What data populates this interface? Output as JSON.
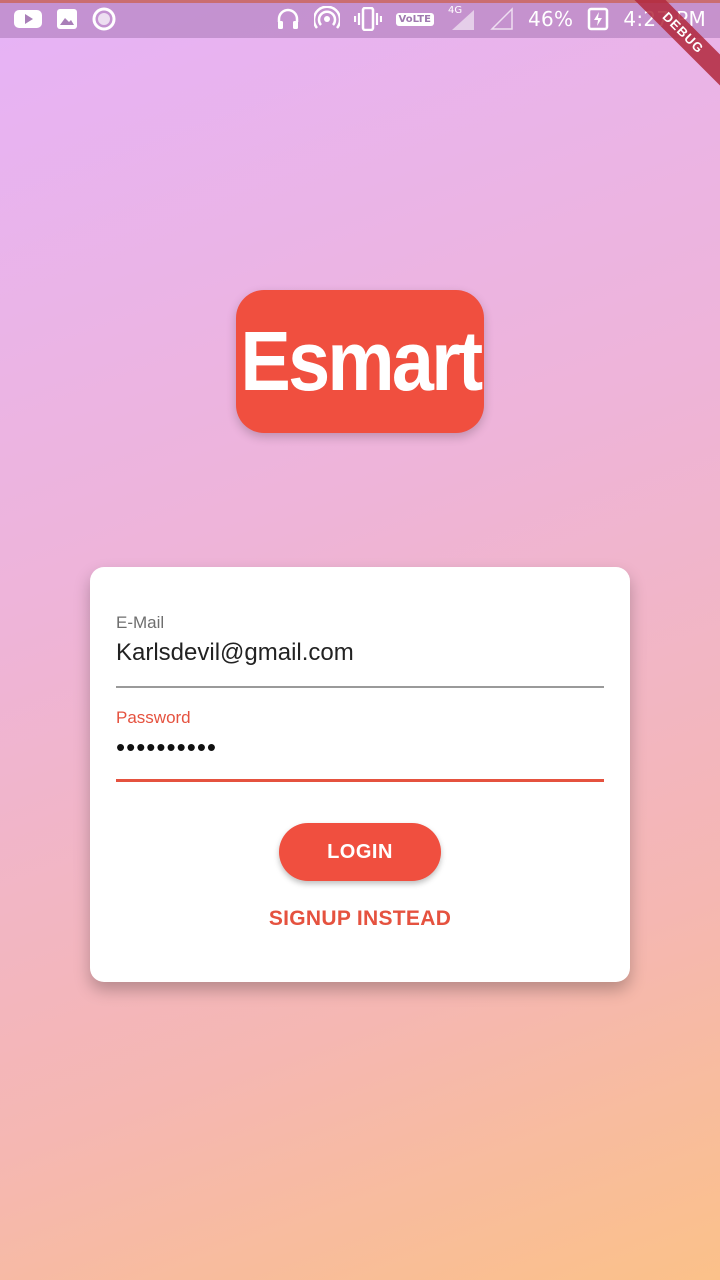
{
  "status_bar": {
    "battery_percent": "46%",
    "time": "4:27 PM",
    "network_type": "4G",
    "volte_label": "VoLTE",
    "left_icons": [
      "youtube-icon",
      "gallery-icon",
      "circle-app-icon"
    ],
    "right_icons": [
      "headphones-icon",
      "hotspot-icon",
      "vibrate-icon",
      "volte-icon",
      "signal-4g-icon",
      "signal-empty-icon",
      "battery-charging-icon"
    ]
  },
  "debug_banner": {
    "label": "DEBUG"
  },
  "logo": {
    "text": "Esmart",
    "color": "#f04f3f"
  },
  "form": {
    "email": {
      "label": "E-Mail",
      "value": "Karlsdevil@gmail.com"
    },
    "password": {
      "label": "Password",
      "value": "••••••••••"
    },
    "login_label": "LOGIN",
    "signup_label": "SIGNUP INSTEAD"
  },
  "colors": {
    "accent": "#f04f3f",
    "accent_text": "#e5523f",
    "gradient_start": "#e6b3f7",
    "gradient_end": "#fbc189"
  }
}
